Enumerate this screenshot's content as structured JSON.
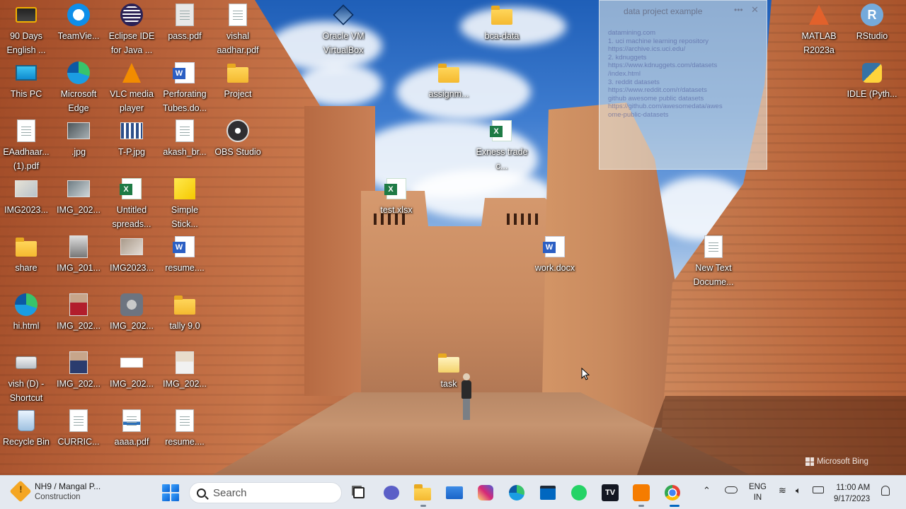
{
  "desktop": {
    "icons": [
      {
        "label": "90 Days English ...",
        "icon": "app-icon"
      },
      {
        "label": "TeamVie...",
        "icon": "teamviewer-icon"
      },
      {
        "label": "Eclipse IDE for Java ...",
        "icon": "eclipse-icon"
      },
      {
        "label": "pass.pdf",
        "icon": "pdf-file-icon"
      },
      {
        "label": "vishal aadhar.pdf",
        "icon": "pdf-file-icon"
      },
      {
        "label": "Oracle VM VirtualBox",
        "icon": "virtualbox-icon"
      },
      {
        "label": "bca-data",
        "icon": "folder-icon"
      },
      {
        "label": "MATLAB R2023a",
        "icon": "matlab-icon"
      },
      {
        "label": "RStudio",
        "icon": "rstudio-icon"
      },
      {
        "label": "This PC",
        "icon": "this-pc-icon"
      },
      {
        "label": "Microsoft Edge",
        "icon": "edge-icon"
      },
      {
        "label": "VLC media player",
        "icon": "vlc-icon"
      },
      {
        "label": "Perforating Tubes.do...",
        "icon": "word-file-icon"
      },
      {
        "label": "Project",
        "icon": "folder-icon"
      },
      {
        "label": "assignm...",
        "icon": "folder-icon"
      },
      {
        "label": "IDLE (Pyth...",
        "icon": "python-idle-icon"
      },
      {
        "label": "EAadhaar... (1).pdf",
        "icon": "pdf-file-icon"
      },
      {
        "label": ".jpg",
        "icon": "image-file-icon"
      },
      {
        "label": "T-P.jpg",
        "icon": "image-file-icon"
      },
      {
        "label": "akash_br...",
        "icon": "document-file-icon"
      },
      {
        "label": "OBS Studio",
        "icon": "obs-icon"
      },
      {
        "label": "Exness trade c...",
        "icon": "excel-file-icon"
      },
      {
        "label": "IMG2023...",
        "icon": "image-file-icon"
      },
      {
        "label": "IMG_202...",
        "icon": "image-file-icon"
      },
      {
        "label": "Untitled spreads...",
        "icon": "excel-file-icon"
      },
      {
        "label": "Simple Stick...",
        "icon": "sticky-notes-icon"
      },
      {
        "label": "test.xlsx",
        "icon": "excel-file-icon"
      },
      {
        "label": "share",
        "icon": "folder-icon"
      },
      {
        "label": "IMG_201...",
        "icon": "image-file-icon"
      },
      {
        "label": "IMG2023...",
        "icon": "image-file-icon"
      },
      {
        "label": "resume....",
        "icon": "word-file-icon"
      },
      {
        "label": "work.docx",
        "icon": "word-file-icon"
      },
      {
        "label": "New Text Docume...",
        "icon": "text-file-icon"
      },
      {
        "label": "hi.html",
        "icon": "edge-html-icon"
      },
      {
        "label": "IMG_202...",
        "icon": "portrait-image-icon"
      },
      {
        "label": "IMG_202...",
        "icon": "image-file-icon"
      },
      {
        "label": "tally 9.0",
        "icon": "folder-icon"
      },
      {
        "label": "vish (D) - Shortcut",
        "icon": "drive-shortcut-icon"
      },
      {
        "label": "IMG_202...",
        "icon": "portrait-image-icon"
      },
      {
        "label": "IMG_202...",
        "icon": "image-file-icon"
      },
      {
        "label": "IMG_202...",
        "icon": "portrait-image-icon"
      },
      {
        "label": "task",
        "icon": "folder-icon"
      },
      {
        "label": "Recycle Bin",
        "icon": "recycle-bin-icon"
      },
      {
        "label": "CURRIC...",
        "icon": "document-file-icon"
      },
      {
        "label": "aaaa.pdf",
        "icon": "pdf-file-icon"
      },
      {
        "label": "resume....",
        "icon": "document-file-icon"
      }
    ],
    "note": {
      "title": "data project example",
      "lines": [
        "datamining.com",
        "1. uci machine learning repository",
        "   https://archive.ics.uci.edu/",
        "2. kdnuggets",
        "   https://www.kdnuggets.com/datasets",
        "   /index.html",
        "3. reddit datasets",
        "   https://www.reddit.com/r/datasets",
        "   github awesome public datasets",
        "   https://github.com/awesomedata/awes",
        "   ome-public-datasets"
      ]
    },
    "watermark": "Microsoft Bing"
  },
  "taskbar": {
    "weather_title": "NH9 / Mangal P...",
    "weather_sub": "Construction",
    "search_placeholder": "Search",
    "apps": [
      {
        "name": "task-view",
        "color": "#222222"
      },
      {
        "name": "teams-chat",
        "color": "#5b5fc7"
      },
      {
        "name": "file-explorer",
        "color": "#f4b930"
      },
      {
        "name": "mail",
        "color": "#1a73e8"
      },
      {
        "name": "instagram",
        "color": "#e1306c"
      },
      {
        "name": "edge",
        "color": "#1d9ad6"
      },
      {
        "name": "microsoft-store",
        "color": "#0067c0"
      },
      {
        "name": "whatsapp",
        "color": "#25d366"
      },
      {
        "name": "tradingview",
        "color": "#131722"
      },
      {
        "name": "app-orange",
        "color": "#f57c00"
      },
      {
        "name": "chrome-app",
        "color": "#e94235"
      }
    ],
    "language_line1": "ENG",
    "language_line2": "IN",
    "time": "11:00 AM",
    "date": "9/17/2023"
  }
}
